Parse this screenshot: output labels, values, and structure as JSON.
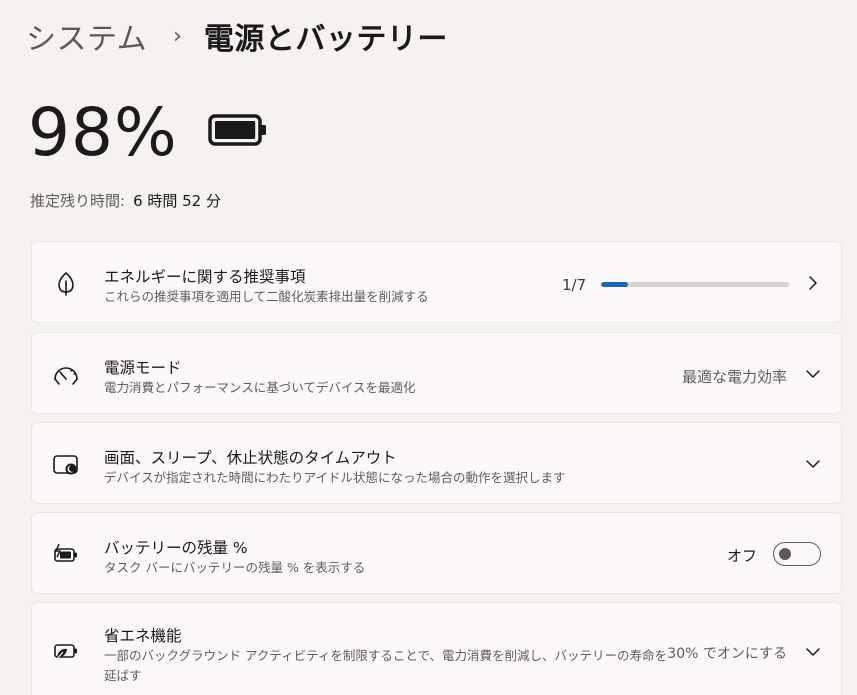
{
  "breadcrumb": {
    "parent": "システム",
    "separator": "›",
    "current": "電源とバッテリー"
  },
  "battery": {
    "percent_text": "98%",
    "level_fraction": 0.98,
    "icon": "battery-full-icon"
  },
  "remaining": {
    "label": "推定残り時間:",
    "value": "6 時間 52 分"
  },
  "cards": [
    {
      "title": "エネルギーに関する推奨事項",
      "description": "これらの推奨事項を適用して二酸化炭素排出量を削減する",
      "icon": "leaf-icon",
      "progress_text": "1/7",
      "progress_fraction": 0.142857,
      "control": "chevron-right-icon"
    },
    {
      "title": "電源モード",
      "description": "電力消費とパフォーマンスに基づいてデバイスを最適化",
      "icon": "power-mode-gauge-icon",
      "value": "最適な電力効率",
      "control": "chevron-down-icon"
    },
    {
      "title": "画面、スリープ、休止状態のタイムアウト",
      "description": "デバイスが指定された時間にわたりアイドル状態になった場合の動作を選択します",
      "icon": "screen-sleep-icon",
      "control": "chevron-down-icon"
    },
    {
      "title": "バッテリーの残量 %",
      "description": "タスク バーにバッテリーの残量 % を表示する",
      "icon": "battery-charging-icon",
      "toggle_label": "オフ",
      "toggle_on": false
    },
    {
      "title": "省エネ機能",
      "description_line1": "一部のバックグラウンド アクティビティを制限することで、電力消費を削減し、バッテリーの寿命を",
      "description_line2": "延ばす",
      "icon": "battery-saver-icon",
      "value": "30% でオンにする",
      "control": "chevron-down-icon"
    }
  ],
  "colors": {
    "background": "#f7f1ef",
    "card": "#fcf9f8",
    "accent": "#1967c5"
  }
}
